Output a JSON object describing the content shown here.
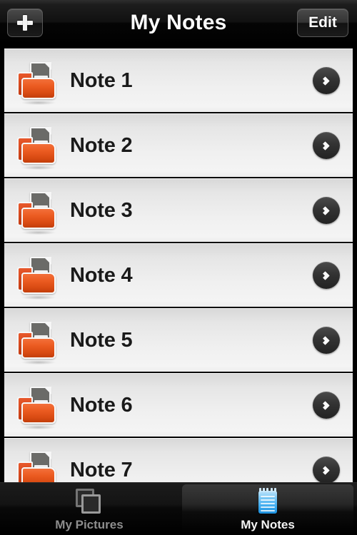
{
  "navbar": {
    "title": "My Notes",
    "add_label": "+",
    "add_icon": "plus-icon",
    "edit_label": "Edit"
  },
  "list": {
    "rows": [
      {
        "label": "Note 1",
        "icon": "folder-document-icon",
        "accessory": "chevron-right-icon"
      },
      {
        "label": "Note 2",
        "icon": "folder-document-icon",
        "accessory": "chevron-right-icon"
      },
      {
        "label": "Note 3",
        "icon": "folder-document-icon",
        "accessory": "chevron-right-icon"
      },
      {
        "label": "Note 4",
        "icon": "folder-document-icon",
        "accessory": "chevron-right-icon"
      },
      {
        "label": "Note 5",
        "icon": "folder-document-icon",
        "accessory": "chevron-right-icon"
      },
      {
        "label": "Note 6",
        "icon": "folder-document-icon",
        "accessory": "chevron-right-icon"
      },
      {
        "label": "Note 7",
        "icon": "folder-document-icon",
        "accessory": "chevron-right-icon"
      }
    ]
  },
  "tabbar": {
    "tabs": [
      {
        "label": "My Pictures",
        "icon": "photos-stack-icon",
        "active": false
      },
      {
        "label": "My Notes",
        "icon": "notepad-icon",
        "active": true
      }
    ]
  },
  "colors": {
    "accent_orange": "#e8572a",
    "chrome_black": "#000000",
    "row_light": "#f0f0f0",
    "tab_active_blue": "#3aa9ee",
    "tab_inactive_gray": "#8e8e8e"
  }
}
